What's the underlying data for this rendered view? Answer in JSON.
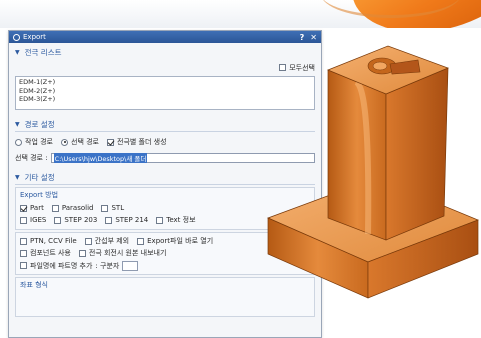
{
  "dialog": {
    "title": "Export",
    "help_btn": "?",
    "close_btn": "✕",
    "sections": {
      "file_list": "전극 리스트",
      "path_settings": "경로 설정",
      "other_settings": "기타 설정"
    },
    "file_list": {
      "select_all": "모두선택",
      "items": [
        "EDM-1(Z+)",
        "EDM-2(Z+)",
        "EDM-3(Z+)"
      ]
    },
    "path": {
      "work_path": "작업 경로",
      "select_path": "선택 경로",
      "create_folder": "전극별 폴더 생성",
      "label": "선택 경로 :",
      "value": "C:\\Users\\hjw\\Desktop\\새 폴더"
    },
    "export_method": {
      "title": "Export 방법",
      "formats": [
        "Part",
        "Parasolid",
        "STL",
        "IGES",
        "STEP 203",
        "STEP 214",
        "Text 정보"
      ],
      "checked": [
        "Part"
      ],
      "options": [
        "PTN, CCV File",
        "간섭부 제외",
        "Export파일 바로 열기",
        "컴포넌트 사용",
        "전극 회전시 원본 내보내기",
        "파일명에 파트명 추가",
        "구분자"
      ]
    },
    "coord_title": "좌표 형식"
  },
  "colors": {
    "accent": "#2c5aa0",
    "titlebar": "#2b5697",
    "selection": "#3b73c7",
    "model_orange": "#e07a2a"
  },
  "icons": {
    "section_chevron": "chevron-down-icon",
    "logo": "app-logo-icon"
  }
}
